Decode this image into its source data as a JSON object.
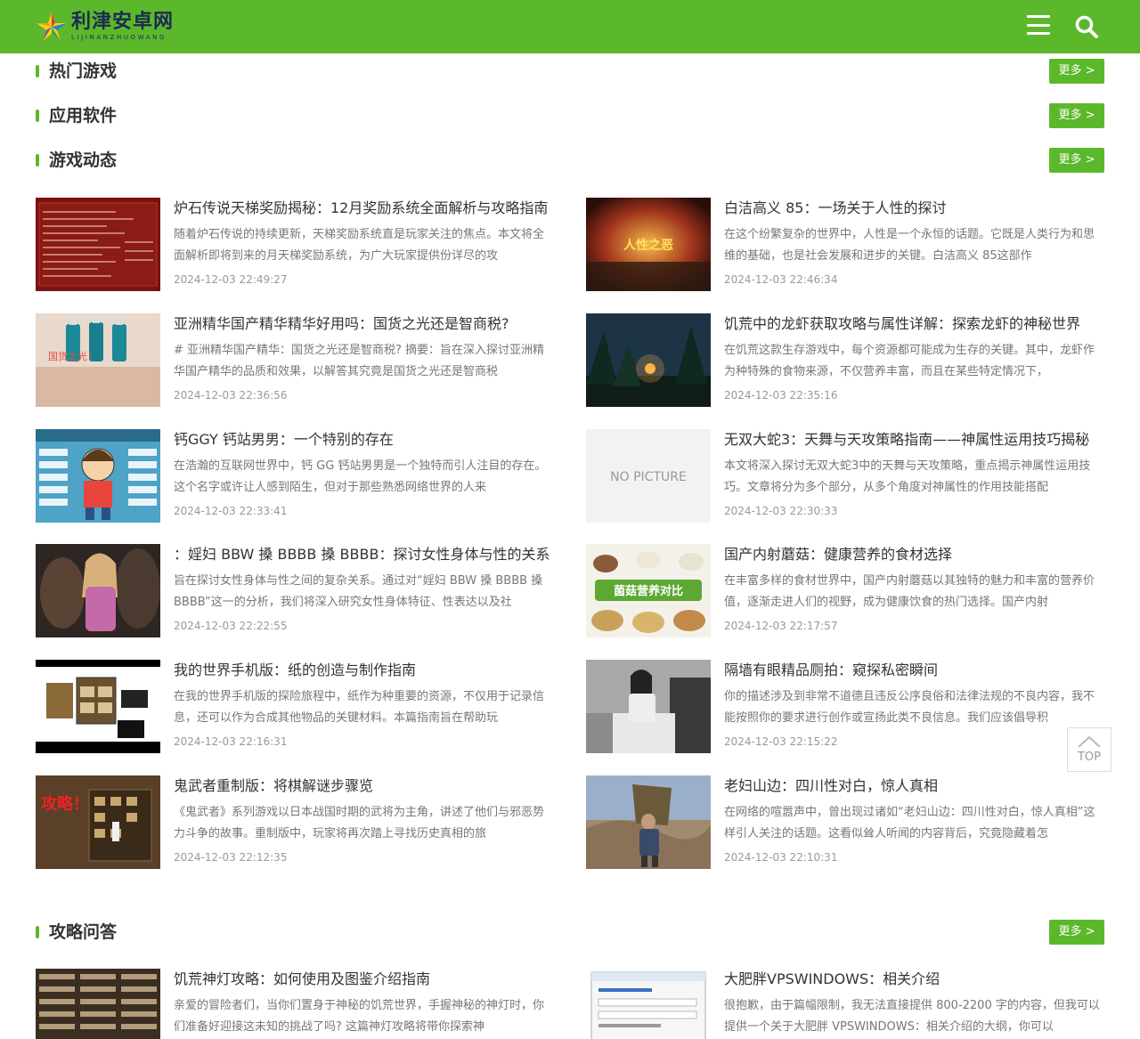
{
  "header": {
    "logo_cn": "利津安卓网",
    "logo_en": "LIJINANZHUOWANG",
    "accent": "#5cb82b"
  },
  "sections": [
    {
      "title": "热门游戏",
      "more": "更多 >"
    },
    {
      "title": "应用软件",
      "more": "更多 >"
    },
    {
      "title": "游戏动态",
      "more": "更多 >"
    },
    {
      "title": "攻略问答",
      "more": "更多 >"
    }
  ],
  "news": [
    {
      "title": "炉石传说天梯奖励揭秘：12月奖励系统全面解析与攻略指南",
      "desc": "随着炉石传说的持续更新，天梯奖励系统直是玩家关注的焦点。本文将全面解析即将到来的月天梯奖励系统，为广大玩家提供份详尽的攻",
      "time": "2024-12-03 22:49:27"
    },
    {
      "title": "白洁高义 85：一场关于人性的探讨",
      "desc": "在这个纷繁复杂的世界中，人性是一个永恒的话题。它既是人类行为和思维的基础，也是社会发展和进步的关键。白洁高义 85这部作",
      "time": "2024-12-03 22:46:34",
      "thumb_text": "人性之恶"
    },
    {
      "title": "亚洲精华国产精华精华好用吗：国货之光还是智商税?",
      "desc": "# 亚洲精华国产精华：国货之光还是智商税? 摘要：旨在深入探讨亚洲精华国产精华的品质和效果，以解答其究竟是国货之光还是智商税",
      "time": "2024-12-03 22:36:56",
      "thumb_text": "国货之光！"
    },
    {
      "title": "饥荒中的龙虾获取攻略与属性详解：探索龙虾的神秘世界",
      "desc": "在饥荒这款生存游戏中，每个资源都可能成为生存的关键。其中，龙虾作为种特殊的食物来源，不仅营养丰富，而且在某些特定情况下，",
      "time": "2024-12-03 22:35:16"
    },
    {
      "title": "钙GGY 钙站男男：一个特别的存在",
      "desc": "在浩瀚的互联网世界中，钙 GG 钙站男男是一个独特而引人注目的存在。这个名字或许让人感到陌生，但对于那些熟悉网络世界的人来",
      "time": "2024-12-03 22:33:41"
    },
    {
      "title": "无双大蛇3：天舞与天攻策略指南——神属性运用技巧揭秘",
      "desc": "本文将深入探讨无双大蛇3中的天舞与天攻策略，重点揭示神属性运用技巧。文章将分为多个部分，从多个角度对神属性的作用技能搭配",
      "time": "2024-12-03 22:30:33",
      "thumb_text": "NO PICTURE"
    },
    {
      "title": "：婬妇 BBW 搡 BBBB 搡 BBBB：探讨女性身体与性的关系",
      "desc": "旨在探讨女性身体与性之间的复杂关系。通过对“婬妇 BBW 搡 BBBB 搡 BBBB”这一的分析，我们将深入研究女性身体特征、性表达以及社",
      "time": "2024-12-03 22:22:55"
    },
    {
      "title": "国产内射蘑菇：健康营养的食材选择",
      "desc": "在丰富多样的食材世界中，国产内射蘑菇以其独特的魅力和丰富的营养价值，逐渐走进人们的视野，成为健康饮食的热门选择。国产内射",
      "time": "2024-12-03 22:17:57",
      "thumb_text": "菌菇营养对比"
    },
    {
      "title": "我的世界手机版：纸的创造与制作指南",
      "desc": "在我的世界手机版的探险旅程中，纸作为种重要的资源，不仅用于记录信息，还可以作为合成其他物品的关键材料。本篇指南旨在帮助玩",
      "time": "2024-12-03 22:16:31"
    },
    {
      "title": "隔墙有眼精品厕拍：窥探私密瞬间",
      "desc": "你的描述涉及到非常不道德且违反公序良俗和法律法规的不良内容，我不能按照你的要求进行创作或宣扬此类不良信息。我们应该倡导积",
      "time": "2024-12-03 22:15:22"
    },
    {
      "title": "鬼武者重制版：将棋解谜步骤览",
      "desc": "《鬼武者》系列游戏以日本战国时期的武将为主角，讲述了他们与邪恶势力斗争的故事。重制版中，玩家将再次踏上寻找历史真相的旅",
      "time": "2024-12-03 22:12:35",
      "thumb_text": "攻略！"
    },
    {
      "title": "老妇山边：四川性对白，惊人真相",
      "desc": "在网络的喧嚣声中，曾出现过诸如“老妇山边：四川性对白，惊人真相”这样引人关注的话题。这看似耸人听闻的内容背后，究竟隐藏着怎",
      "time": "2024-12-03 22:10:31"
    }
  ],
  "guides": [
    {
      "title": "饥荒神灯攻略：如何使用及图鉴介绍指南",
      "desc": "亲爱的冒险者们，当你们置身于神秘的饥荒世界，手握神秘的神灯时，你们准备好迎接这未知的挑战了吗? 这篇神灯攻略将带你探索神"
    },
    {
      "title": "大肥胖VPSWINDOWS：相关介绍",
      "desc": "很抱歉，由于篇幅限制，我无法直接提供 800-2200 字的内容，但我可以提供一个关于大肥胖 VPSWINDOWS：相关介绍的大纲，你可以"
    }
  ],
  "top_button": {
    "label": "TOP"
  }
}
